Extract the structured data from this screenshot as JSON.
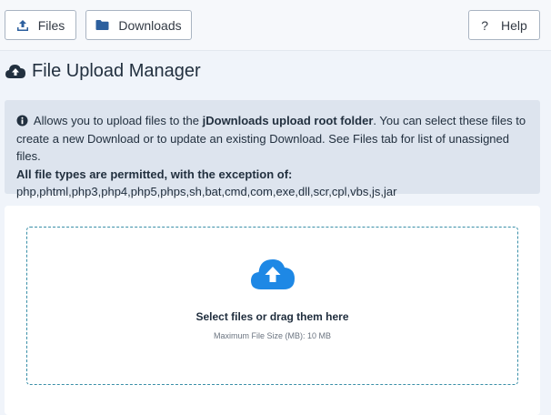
{
  "toolbar": {
    "files_label": "Files",
    "downloads_label": "Downloads",
    "help_label": "Help",
    "help_icon": "?"
  },
  "header": {
    "title": "File Upload Manager"
  },
  "info": {
    "intro": " Allows you to upload files to the ",
    "folder_label": "jDownloads upload root folder",
    "text_rest": ". You can select these files to create a new Download or to update an existing Download. See Files tab for list of unassigned files.",
    "permitted_label": "All file types are permitted, with the exception of:",
    "excluded_types": "php,phtml,php3,php4,php5,phps,sh,bat,cmd,com,exe,dll,scr,cpl,vbs,js,jar"
  },
  "dropzone": {
    "main_text": "Select files or drag them here",
    "max_size_text": "Maximum File Size (MB): 10 MB"
  },
  "colors": {
    "accent_blue": "#1e88e5",
    "toolbar_icon": "#2c5f9e",
    "dropzone_border": "#3a8fa8"
  },
  "icons": [
    "upload-icon",
    "folder-icon",
    "cloud-upload-icon",
    "info-icon"
  ]
}
